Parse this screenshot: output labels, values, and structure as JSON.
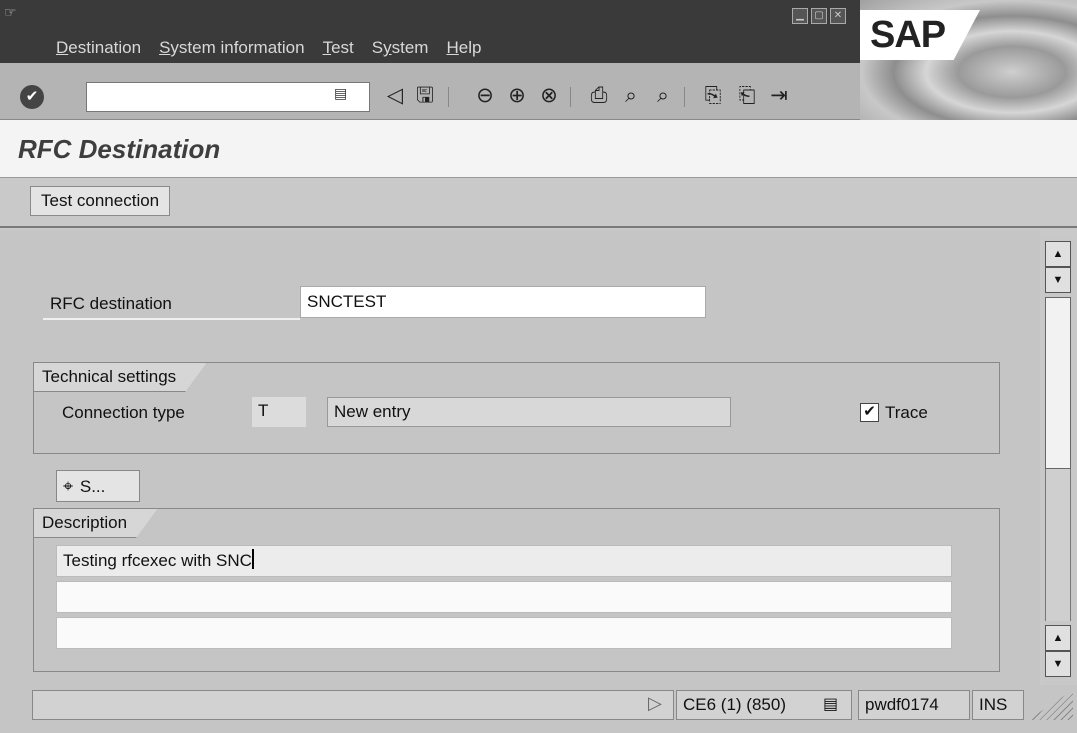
{
  "menubar": {
    "items": [
      {
        "first": "D",
        "rest": "estination"
      },
      {
        "first": "S",
        "rest": "ystem information"
      },
      {
        "first": "T",
        "rest": "est"
      },
      {
        "first": "S",
        "rest": "ystem",
        "prefix": "S",
        "u": "y",
        "suffix": "stem"
      },
      {
        "first": "H",
        "rest": "elp"
      }
    ]
  },
  "logo": {
    "text": "SAP"
  },
  "toolbar": {
    "command_value": "",
    "icons": [
      "enter-icon",
      "back-icon",
      "save-icon",
      "back-nav-icon",
      "exit-icon",
      "cancel-icon",
      "print-icon",
      "find-icon",
      "find-next-icon",
      "first-page-icon",
      "last-page-icon",
      "layout-icon"
    ]
  },
  "page": {
    "title": "RFC Destination"
  },
  "app_toolbar": {
    "test_connection": "Test connection"
  },
  "form": {
    "rfc_destination_label": "RFC destination",
    "rfc_destination_value": "SNCTEST",
    "technical_settings": {
      "title": "Technical settings",
      "connection_type_label": "Connection type",
      "connection_type_value": "T",
      "connection_type_desc": "New entry",
      "trace_checked": true,
      "trace_label": "Trace"
    },
    "search_button_label": "S...",
    "description": {
      "title": "Description",
      "lines": [
        "Testing rfcexec with SNC",
        "",
        ""
      ]
    }
  },
  "statusbar": {
    "system": "CE6 (1) (850)",
    "server": "pwdf0174",
    "mode": "INS"
  }
}
